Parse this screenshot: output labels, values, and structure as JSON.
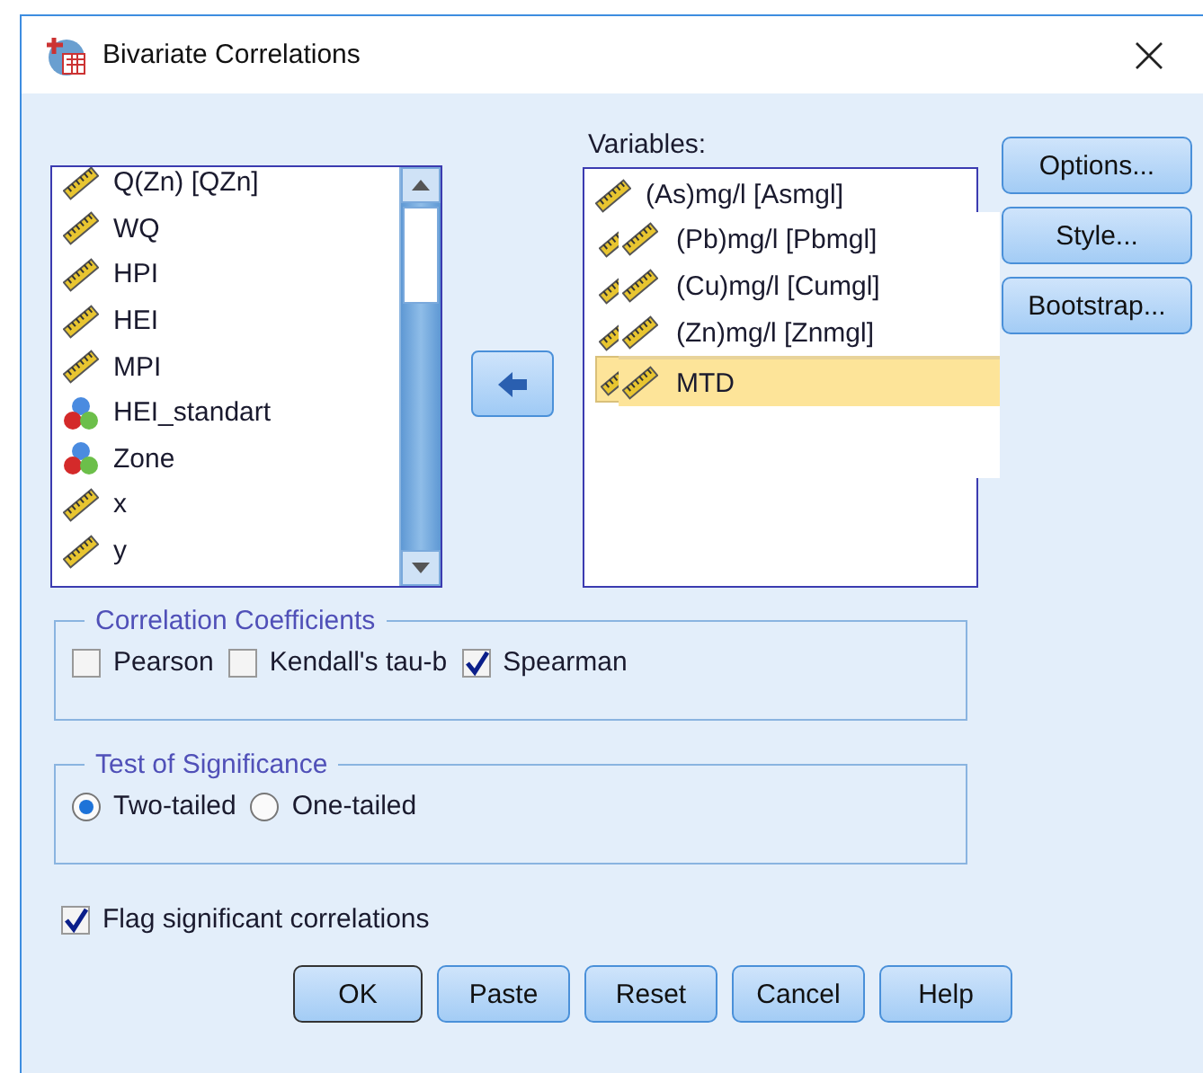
{
  "window": {
    "title": "Bivariate Correlations"
  },
  "source_variables": [
    {
      "label": "Q(Zn) [QZn]",
      "kind": "scale"
    },
    {
      "label": "WQ",
      "kind": "scale"
    },
    {
      "label": "HPI",
      "kind": "scale"
    },
    {
      "label": "HEI",
      "kind": "scale"
    },
    {
      "label": "MPI",
      "kind": "scale"
    },
    {
      "label": "HEI_standart",
      "kind": "nominal"
    },
    {
      "label": "Zone",
      "kind": "nominal"
    },
    {
      "label": "x",
      "kind": "scale"
    },
    {
      "label": "y",
      "kind": "scale"
    }
  ],
  "variables_label": "Variables:",
  "variables": [
    {
      "label": "(As)mg/l [Asmgl]",
      "kind": "scale"
    }
  ],
  "drag_preview": [
    {
      "label": "(Pb)mg/l [Pbmgl]",
      "kind": "scale",
      "selected": false
    },
    {
      "label": "(Cu)mg/l [Cumgl]",
      "kind": "scale",
      "selected": false
    },
    {
      "label": "(Zn)mg/l [Znmgl]",
      "kind": "scale",
      "selected": false
    },
    {
      "label": "MTD",
      "kind": "scale",
      "selected": true
    }
  ],
  "side_buttons": [
    "Options...",
    "Style...",
    "Bootstrap..."
  ],
  "correlation_coefficients": {
    "title": "Correlation Coefficients",
    "options": [
      {
        "label": "Pearson",
        "checked": false
      },
      {
        "label": "Kendall's tau-b",
        "checked": false
      },
      {
        "label": "Spearman",
        "checked": true
      }
    ]
  },
  "test_of_significance": {
    "title": "Test of Significance",
    "options": [
      {
        "label": "Two-tailed",
        "selected": true
      },
      {
        "label": "One-tailed",
        "selected": false
      }
    ]
  },
  "flag": {
    "label": "Flag significant correlations",
    "checked": true
  },
  "buttons": [
    {
      "label": "OK",
      "default": true
    },
    {
      "label": "Paste",
      "default": false
    },
    {
      "label": "Reset",
      "default": false
    },
    {
      "label": "Cancel",
      "default": false
    },
    {
      "label": "Help",
      "default": false
    }
  ]
}
